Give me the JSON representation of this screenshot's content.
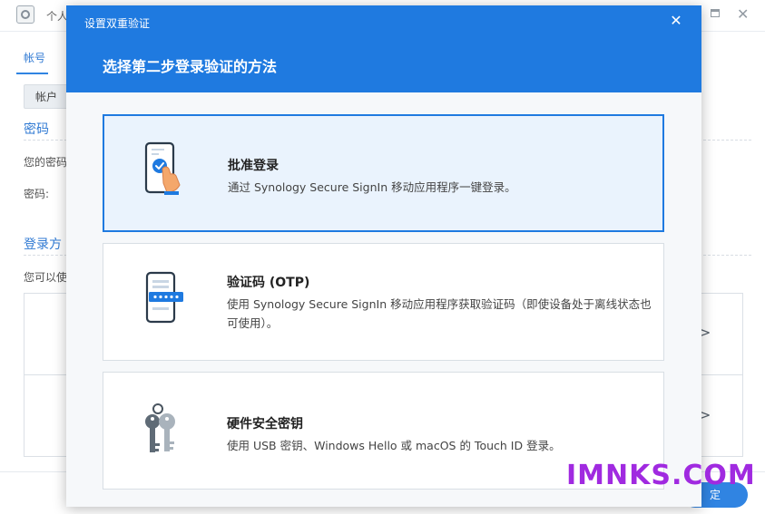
{
  "background": {
    "window_title": "个人",
    "tab_account": "帐号",
    "subtab_account": "帐户",
    "section_password": "密码",
    "text_your_password": "您的密码",
    "label_password": "密码:",
    "section_login": "登录方",
    "text_you_can": "您可以使",
    "button_partial": "定"
  },
  "modal": {
    "title": "设置双重验证",
    "heading": "选择第二步登录验证的方法",
    "options": [
      {
        "title": "批准登录",
        "desc": "通过 Synology Secure SignIn 移动应用程序一键登录。",
        "icon": "phone-approve-icon"
      },
      {
        "title": "验证码 (OTP)",
        "desc": "使用 Synology Secure SignIn 移动应用程序获取验证码（即使设备处于离线状态也可使用）。",
        "icon": "phone-otp-icon"
      },
      {
        "title": "硬件安全密钥",
        "desc": "使用 USB 密钥、Windows Hello 或 macOS 的 Touch ID 登录。",
        "icon": "keys-icon"
      }
    ]
  },
  "watermark": "IMNKS.COM",
  "colors": {
    "accent": "#1f7ae0",
    "selected_bg": "#eaf3fd",
    "watermark": "#a02ae0"
  }
}
